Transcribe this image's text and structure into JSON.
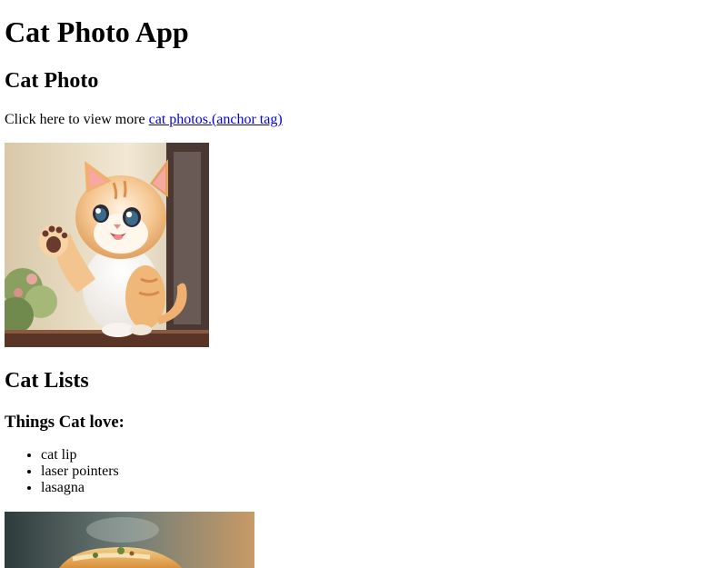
{
  "page": {
    "title": "Cat Photo App"
  },
  "photo_section": {
    "heading": "Cat Photo",
    "intro_text": "Click here to view more ",
    "link_text": "cat photos.(anchor tag)",
    "image_alt": "A cute orange cat waving"
  },
  "lists_section": {
    "heading": "Cat Lists",
    "subheading": "Things Cat love:",
    "items": [
      "cat lip",
      "laser pointers",
      "lasagna"
    ],
    "image_alt": "A slice of lasagna"
  }
}
